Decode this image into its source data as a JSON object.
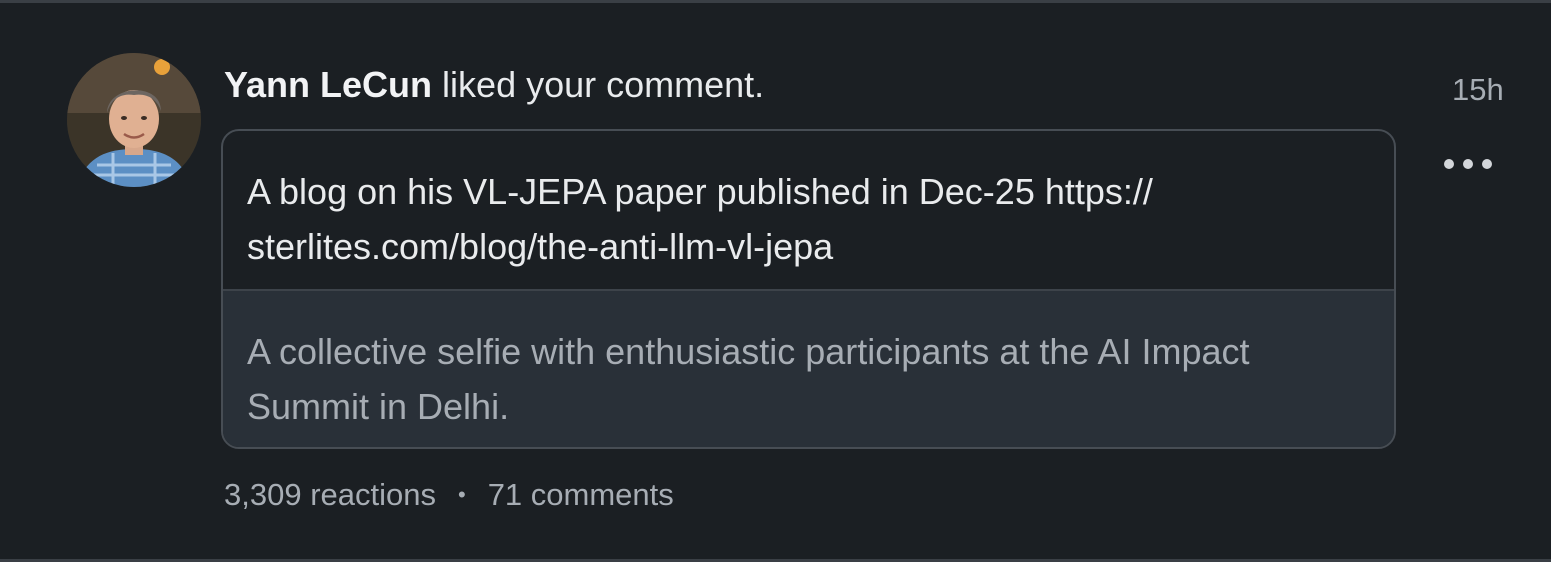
{
  "notification": {
    "actor_name": "Yann LeCun",
    "action_text": "liked your comment.",
    "time_ago": "15h",
    "more_icon": "more-horizontal-icon",
    "comment_text": "A blog on his VL-JEPA paper published in Dec-25 https:// sterlites.com/blog/the-anti-llm-vl-jepa",
    "post_text": "A collective selfie with enthusiastic participants at the AI Impact Summit in Delhi.",
    "reactions": "3,309 reactions",
    "separator": "•",
    "comments": "71 comments"
  },
  "colors": {
    "background": "#1b1f23",
    "post_background": "#293038",
    "primary_text": "#e9ebed",
    "secondary_text": "#a7adb4",
    "border": "#474d54"
  }
}
